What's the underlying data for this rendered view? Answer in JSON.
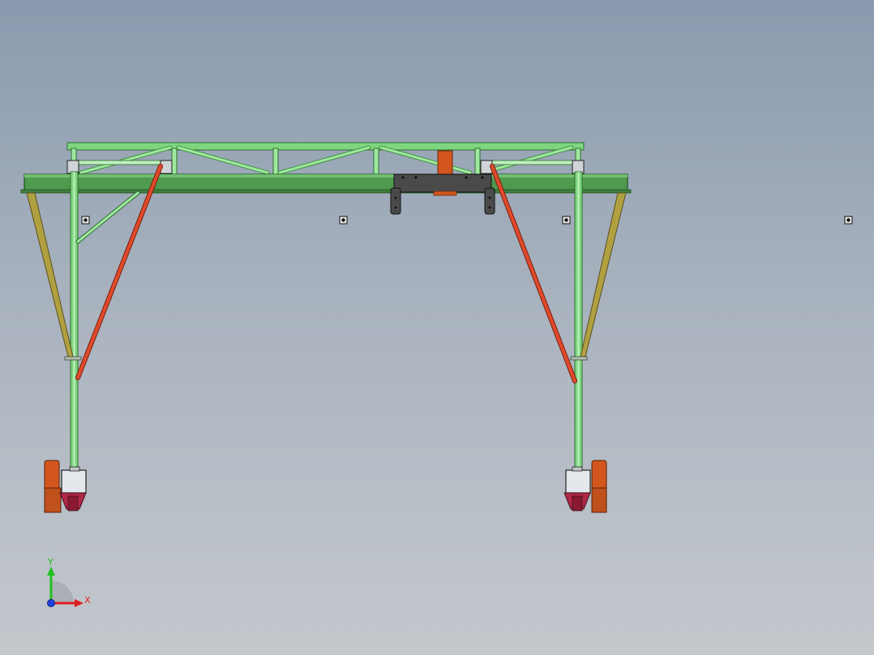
{
  "viewport": {
    "background_top": "#8a9aae",
    "background_bottom": "#c4c8cd"
  },
  "model": {
    "colors": {
      "frame_green": "#7fd67f",
      "frame_dark": "#3f8f3f",
      "beam_green": "#4f9a4f",
      "red_brace": "#e04a2a",
      "olive_brace": "#b0a040",
      "motor_orange": "#d2561e",
      "wheel_crimson": "#b02848",
      "trolley_grey": "#4a4a4a",
      "block_grey": "#d0d4d8"
    },
    "icons": [
      "point-marker-icon",
      "point-marker-icon",
      "point-marker-icon",
      "point-marker-icon"
    ]
  },
  "triad": {
    "x_label": "X",
    "y_label": "Y",
    "x_color": "#e02020",
    "y_color": "#20c020",
    "z_color": "#2040e0"
  }
}
